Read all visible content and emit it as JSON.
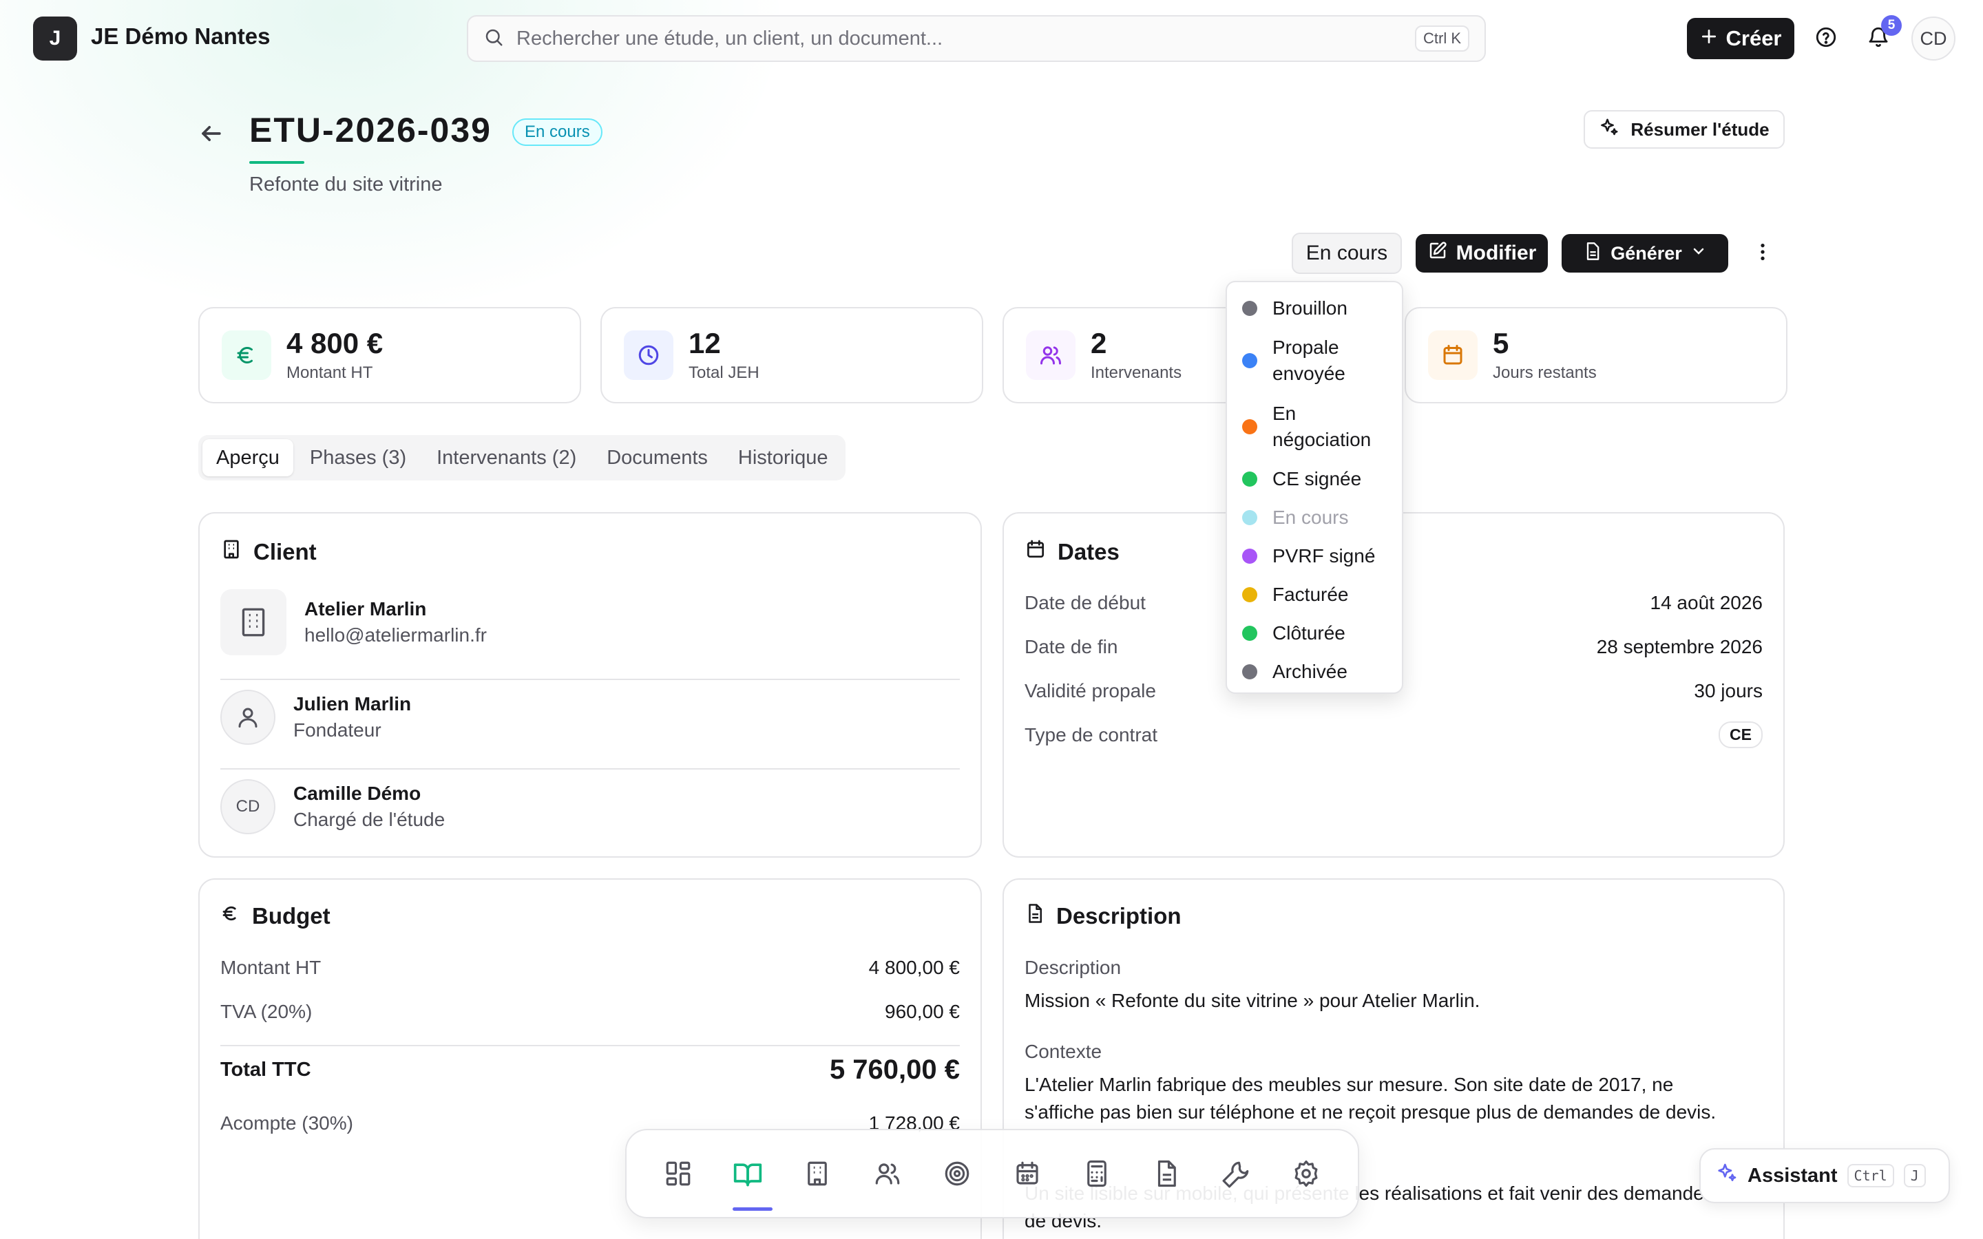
{
  "topbar": {
    "logo_letter": "J",
    "org_name": "JE Démo Nantes",
    "search_placeholder": "Rechercher une étude, un client, un document...",
    "search_shortcut": "Ctrl K",
    "create_label": "Créer",
    "notification_count": "5",
    "user_initials": "CD"
  },
  "study": {
    "code": "ETU-2026-039",
    "status_badge": "En cours",
    "subtitle": "Refonte du site vitrine",
    "summary_button": "Résumer l'étude"
  },
  "actions": {
    "status_button": "En cours",
    "modify_label": "Modifier",
    "generate_label": "Générer"
  },
  "status_menu": {
    "items": [
      {
        "label": "Brouillon",
        "color": "#71717a"
      },
      {
        "label": "Propale envoyée",
        "color": "#3b82f6"
      },
      {
        "label": "En négociation",
        "color": "#f97316"
      },
      {
        "label": "CE signée",
        "color": "#22c55e"
      },
      {
        "label": "En cours",
        "color": "#7dd3e8"
      },
      {
        "label": "PVRF signé",
        "color": "#a855f7"
      },
      {
        "label": "Facturée",
        "color": "#eab308"
      },
      {
        "label": "Clôturée",
        "color": "#22c55e"
      },
      {
        "label": "Archivée",
        "color": "#71717a"
      }
    ]
  },
  "stats": [
    {
      "value": "4 800 €",
      "label": "Montant HT",
      "icon": "euro-icon",
      "color": "#059669",
      "bg": "#ecfdf5"
    },
    {
      "value": "12",
      "label": "Total JEH",
      "icon": "clock-icon",
      "color": "#4f46e5",
      "bg": "#eef2ff"
    },
    {
      "value": "2",
      "label": "Intervenants",
      "icon": "users-icon",
      "color": "#9333ea",
      "bg": "#faf5ff"
    },
    {
      "value": "5",
      "label": "Jours restants",
      "icon": "calendar-icon",
      "color": "#d97706",
      "bg": "#fff7ed"
    }
  ],
  "tabs": [
    "Aperçu",
    "Phases (3)",
    "Intervenants (2)",
    "Documents",
    "Historique"
  ],
  "client_panel": {
    "title": "Client",
    "company_name": "Atelier Marlin",
    "company_email": "hello@ateliermarlin.fr",
    "contact_name": "Julien Marlin",
    "contact_role": "Fondateur",
    "manager_initials": "CD",
    "manager_name": "Camille Démo",
    "manager_role": "Chargé de l'étude"
  },
  "dates_panel": {
    "title": "Dates",
    "rows": [
      {
        "label": "Date de début",
        "value": "14 août 2026"
      },
      {
        "label": "Date de fin",
        "value": "28 septembre 2026"
      },
      {
        "label": "Validité propale",
        "value": "30 jours"
      }
    ],
    "contract_label": "Type de contrat",
    "contract_value": "CE"
  },
  "budget_panel": {
    "title": "Budget",
    "ht_label": "Montant HT",
    "ht_value": "4 800,00 €",
    "tva_label": "TVA (20%)",
    "tva_value": "960,00 €",
    "ttc_label": "Total TTC",
    "ttc_value": "5 760,00 €",
    "deposit_label": "Acompte (30%)",
    "deposit_value": "1 728,00 €"
  },
  "description_panel": {
    "title": "Description",
    "desc_label": "Description",
    "desc_text": "Mission « Refonte du site vitrine » pour Atelier Marlin.",
    "context_label": "Contexte",
    "context_line1": "L'Atelier Marlin fabrique des meubles sur mesure. Son site date de 2017, ne",
    "context_line2": "s'affiche pas bien sur téléphone et ne reçoit presque plus de demandes de devis.",
    "objective_line1": "Un site lisible sur mobile, qui présente les réalisations et fait venir des demandes",
    "objective_line2": "de devis."
  },
  "dock": {
    "items": [
      "dashboard-icon",
      "book-icon",
      "building-icon",
      "users-icon",
      "target-icon",
      "calendar-icon",
      "calculator-icon",
      "document-icon",
      "wrench-icon",
      "settings-icon"
    ],
    "active_index": 1
  },
  "assistant": {
    "label": "Assistant",
    "kbd_ctrl": "Ctrl",
    "kbd_key": "J"
  }
}
